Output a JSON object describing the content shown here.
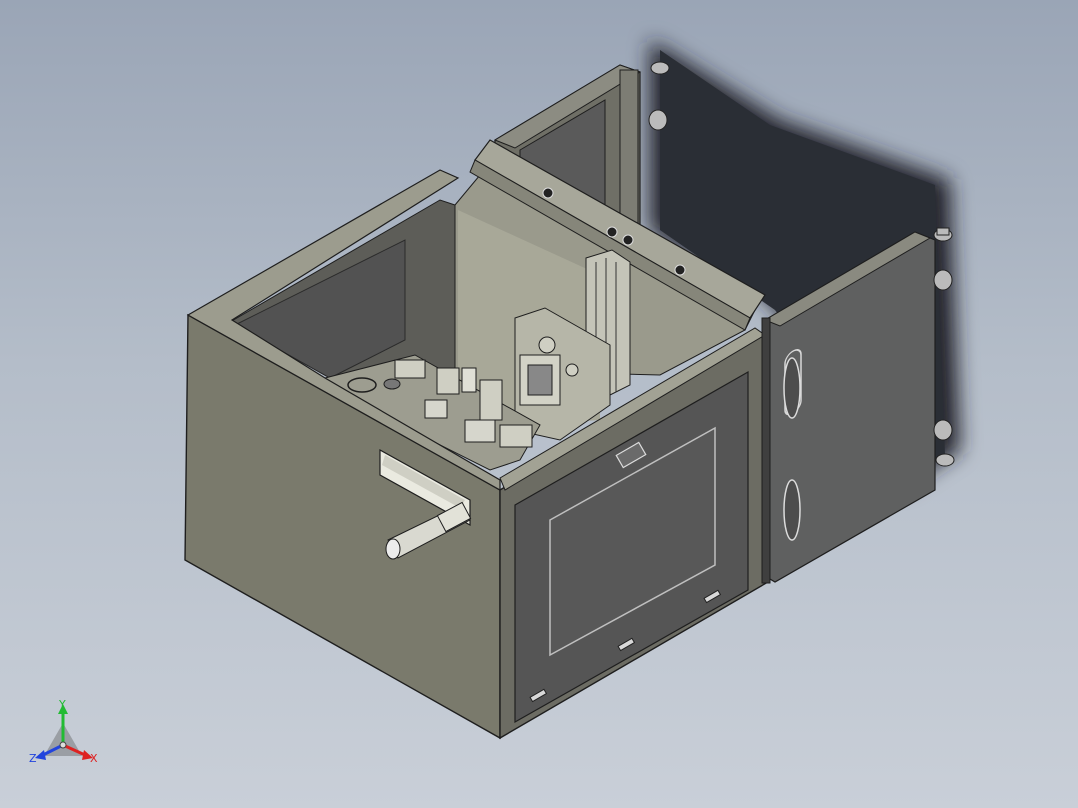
{
  "viewport": {
    "background_top": "#9aa5b6",
    "background_bottom": "#c9cfd8"
  },
  "model": {
    "body_color": "#7a7a6c",
    "panel_color": "#5e5e5e",
    "dark_color": "#2c3036",
    "edge_color": "#1e1e1e"
  },
  "triad": {
    "y_label": "Y",
    "x_label": "X",
    "z_label": "Z",
    "y_color": "#22bb33",
    "x_color": "#dd2222",
    "z_color": "#2244dd"
  }
}
